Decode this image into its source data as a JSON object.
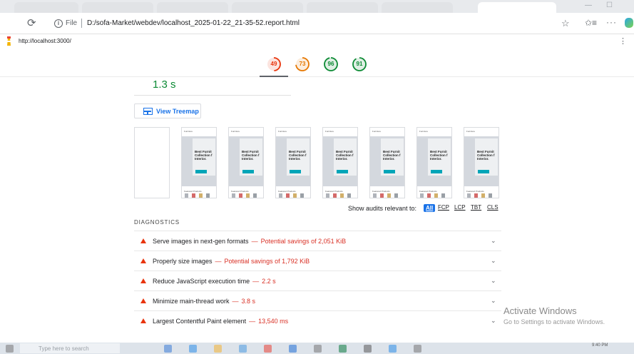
{
  "browser": {
    "address": {
      "file_label": "File",
      "url": "D:/sofa-Market/webdev/localhost_2025-01-22_21-35-52.report.html"
    }
  },
  "report": {
    "tested_url": "http://localhost:3000/",
    "scores": [
      {
        "value": "49",
        "color": "#e8340c",
        "fill": 0.49
      },
      {
        "value": "73",
        "color": "#e67700",
        "fill": 0.73
      },
      {
        "value": "96",
        "color": "#0c8a34",
        "fill": 0.96
      },
      {
        "value": "91",
        "color": "#0c8a34",
        "fill": 0.91
      }
    ],
    "lcp_value": "1.3 s",
    "view_treemap_label": "View Treemap",
    "filmstrip": {
      "nav_text": "Furniture",
      "hero_title": "Best Furnit\nCollection f\nInterior.",
      "section_label": "Featured Products"
    },
    "filter": {
      "label": "Show audits relevant to:",
      "all": "All",
      "fcp": "FCP",
      "lcp": "LCP",
      "tbt": "TBT",
      "cls": "CLS"
    },
    "diagnostics_heading": "DIAGNOSTICS",
    "audits": [
      {
        "title": "Serve images in next-gen formats",
        "value": "Potential savings of 2,051 KiB"
      },
      {
        "title": "Properly size images",
        "value": "Potential savings of 1,792 KiB"
      },
      {
        "title": "Reduce JavaScript execution time",
        "value": "2.2 s"
      },
      {
        "title": "Minimize main-thread work",
        "value": "3.8 s"
      },
      {
        "title": "Largest Contentful Paint element",
        "value": "13,540 ms"
      }
    ],
    "dash": "—"
  },
  "watermark": {
    "title": "Activate Windows",
    "subtitle": "Go to Settings to activate Windows."
  },
  "taskbar": {
    "search_placeholder": "Type here to search",
    "clock": "9:40 PM"
  },
  "colors": {
    "fail": "#e8340c",
    "average": "#e67700",
    "pass": "#0c8a34",
    "accent": "#1a73e8"
  }
}
